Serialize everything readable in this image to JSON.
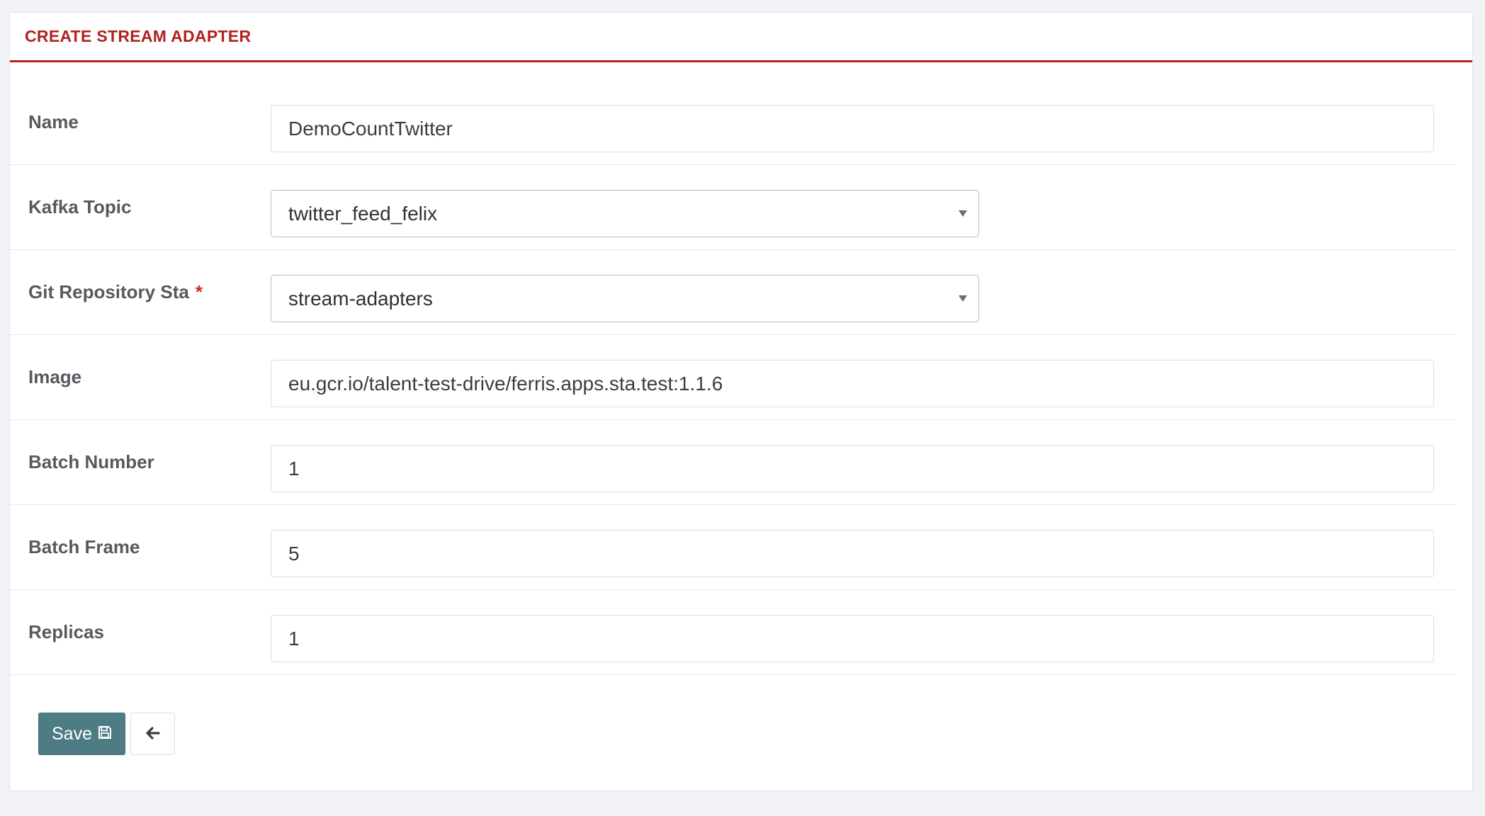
{
  "header": {
    "title": "CREATE STREAM ADAPTER"
  },
  "form": {
    "fields": [
      {
        "label": "Name",
        "value": "DemoCountTwitter",
        "type": "text"
      },
      {
        "label": "Kafka Topic",
        "value": "twitter_feed_felix",
        "type": "select"
      },
      {
        "label": "Git Repository Sta",
        "value": "stream-adapters",
        "type": "select",
        "required_mark": "*"
      },
      {
        "label": "Image",
        "value": "eu.gcr.io/talent-test-drive/ferris.apps.sta.test:1.1.6",
        "type": "text"
      },
      {
        "label": "Batch Number",
        "value": "1",
        "type": "text"
      },
      {
        "label": "Batch Frame",
        "value": "5",
        "type": "text"
      },
      {
        "label": "Replicas",
        "value": "1",
        "type": "text"
      }
    ]
  },
  "actions": {
    "save_label": "Save",
    "save_icon": "floppy-disk-icon",
    "back_icon": "arrow-left-icon"
  },
  "colors": {
    "accent": "#b0221f",
    "save_button": "#4e7c84",
    "required": "#d42a25"
  }
}
